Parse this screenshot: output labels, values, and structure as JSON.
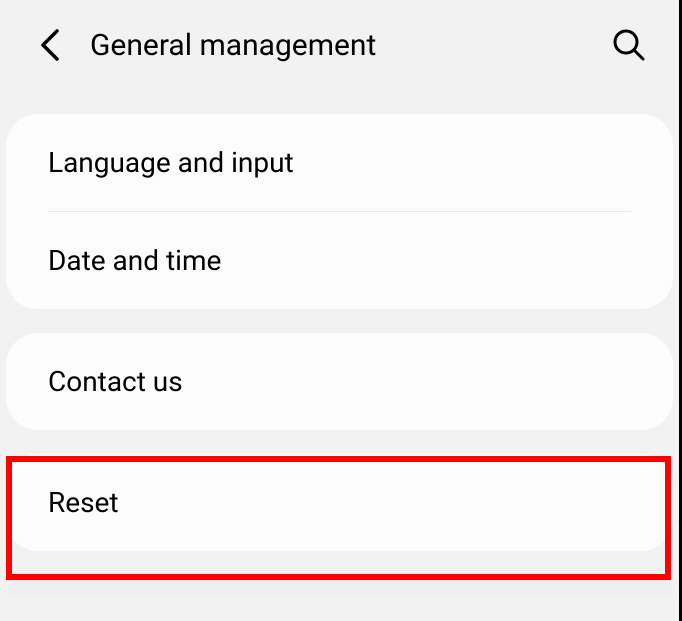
{
  "header": {
    "title": "General management"
  },
  "groups": [
    {
      "items": [
        {
          "label": "Language and input"
        },
        {
          "label": "Date and time"
        }
      ]
    },
    {
      "items": [
        {
          "label": "Contact us"
        }
      ]
    },
    {
      "items": [
        {
          "label": "Reset"
        }
      ]
    }
  ]
}
